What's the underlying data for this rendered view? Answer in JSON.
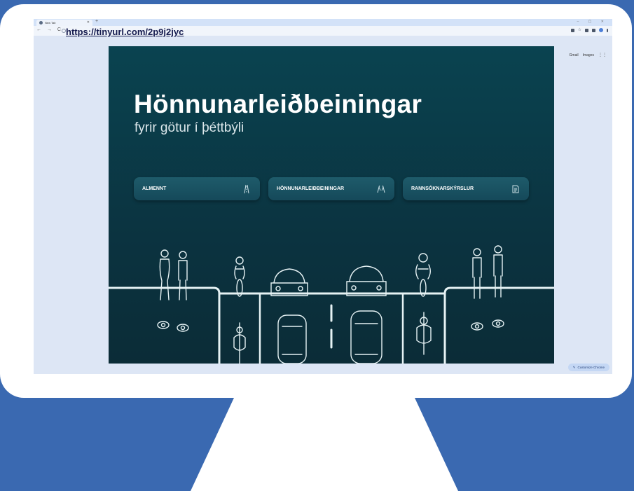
{
  "browser": {
    "tab_title": "New Tab",
    "new_tab": "+",
    "window_controls": "– ▢ ✕",
    "nav": "← → C",
    "url": "https://tinyurl.com/2p9j2jyc"
  },
  "ntp": {
    "gmail": "Gmail",
    "images": "Images",
    "customize": "Customize Chrome"
  },
  "site": {
    "title": "Hönnunarleiðbeiningar",
    "subtitle": "fyrir götur í þéttbýli",
    "cards": [
      {
        "label": "ALMENNT",
        "icon": "road-icon"
      },
      {
        "label": "HÖNNUNARLEIÐBEININGAR",
        "icon": "hands-icon"
      },
      {
        "label": "RANNSÓKNARSKÝRSLUR",
        "icon": "document-icon"
      }
    ]
  },
  "colors": {
    "background": "#3a69b1",
    "site_bg": "#0b3340",
    "line_art": "#e6f2f4"
  }
}
